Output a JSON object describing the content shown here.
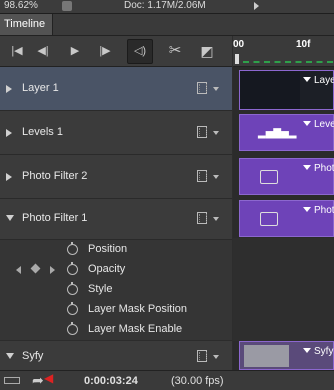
{
  "status_bar": {
    "zoom": "98.62%",
    "doc_info": "Doc: 1.17M/2.06M"
  },
  "panel": {
    "tab_label": "Timeline"
  },
  "toolbar": {
    "buttons": [
      {
        "name": "go-to-first-frame",
        "glyph": "|◀"
      },
      {
        "name": "previous-frame",
        "glyph": "◀|"
      },
      {
        "name": "play",
        "glyph": "▶"
      },
      {
        "name": "next-frame",
        "glyph": "|▶"
      },
      {
        "name": "audio",
        "glyph": "◁)"
      },
      {
        "name": "split-at-playhead",
        "glyph": "✂"
      },
      {
        "name": "transition",
        "glyph": "◩"
      }
    ]
  },
  "ruler": {
    "labels": [
      "00",
      "10f"
    ]
  },
  "layers": [
    {
      "label": "Layer 1",
      "expanded": false,
      "selected": true,
      "clip": "Laye"
    },
    {
      "label": "Levels 1",
      "expanded": false,
      "selected": false,
      "clip": "Leve"
    },
    {
      "label": "Photo Filter 2",
      "expanded": false,
      "selected": false,
      "clip": "Photo"
    },
    {
      "label": "Photo Filter 1",
      "expanded": true,
      "selected": false,
      "clip": "Photo"
    }
  ],
  "properties": [
    "Position",
    "Opacity",
    "Style",
    "Layer Mask Position",
    "Layer Mask Enable"
  ],
  "last_layer": {
    "label": "Syfy",
    "clip": "Syfy"
  },
  "bottom_bar": {
    "timecode": "0:00:03:24",
    "fps": "(30.00 fps)"
  }
}
